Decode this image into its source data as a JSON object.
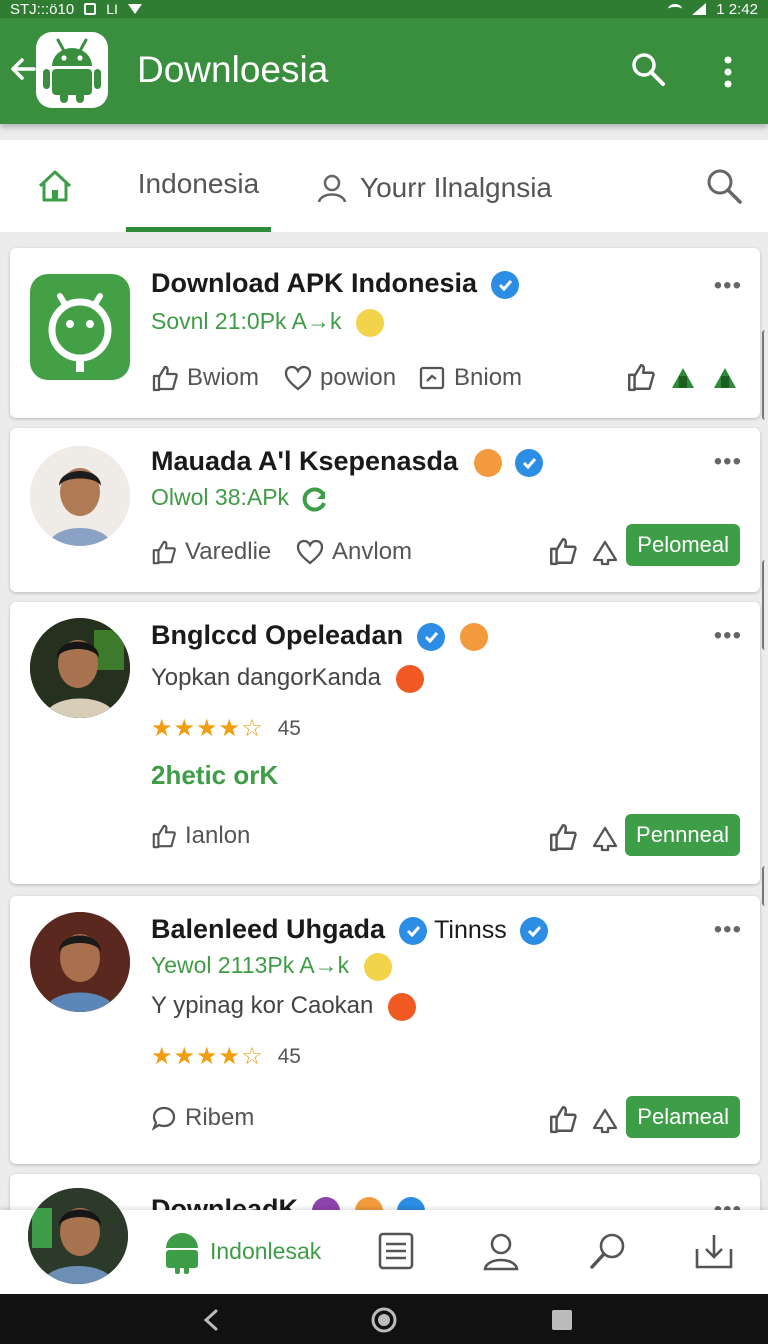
{
  "status_bar": {
    "left_text": "STJ:::ö10",
    "time": "1 2:42"
  },
  "app_bar": {
    "title": "Downloesia"
  },
  "tabs": {
    "tab1_label": "Indonesia",
    "tab2_label": "Yourr Ilnalgnsia"
  },
  "cards": [
    {
      "name": "Download APK Indonesia",
      "subtitle": "Sovnl 21:0Pk A→k",
      "actions": [
        "Bwiom",
        "powion",
        "Bniom"
      ]
    },
    {
      "name": "Mauada A'l Ksepenasda",
      "subtitle": "Olwol 38:APk",
      "actions": [
        "Varedlie",
        "Anvlom"
      ],
      "button": "Pelomeal"
    },
    {
      "name": "Bnglccd Opeleadan",
      "description": "Yopkan dangorKanda",
      "rating_count": "45",
      "rating": 3.5,
      "highlight": "2hetic orK",
      "actions": [
        "Ianlon"
      ],
      "button": "Pennneal"
    },
    {
      "name": "Balenleed Uhgada",
      "name_extra": "Tinnss",
      "subtitle": "Yewol 2113Pk A→k",
      "description": "Y ypinag kor Caokan",
      "rating_count": "45",
      "rating": 3.5,
      "actions": [
        "Ribem"
      ],
      "button": "Pelameal"
    },
    {
      "name": "DownleadK"
    }
  ],
  "bottom_nav": {
    "active_label": "Indonlesak"
  },
  "colors": {
    "primary": "#3a8f3e",
    "accent_green": "#3e9d47",
    "star": "#f29d10",
    "verified": "#2b8de4"
  }
}
